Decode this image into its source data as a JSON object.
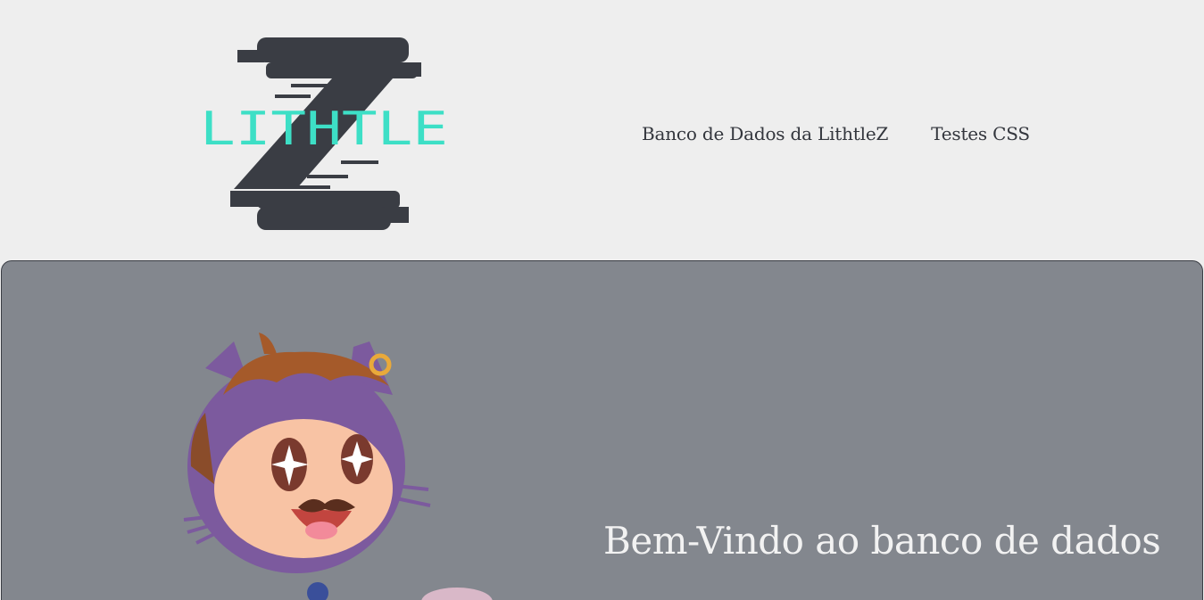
{
  "brand": {
    "logo_text": "LITHTLE",
    "logo_letter": "Z",
    "logo_text_color": "#3ddfc6",
    "logo_shape_color": "#3a3d44"
  },
  "nav": {
    "items": [
      {
        "label": "Banco de Dados da LithtleZ"
      },
      {
        "label": "Testes CSS"
      }
    ]
  },
  "hero": {
    "title": "Bem-Vindo ao banco de dados",
    "background": "#83878e",
    "illustration": "octocat-mascot"
  },
  "colors": {
    "page_bg": "#eeeeee",
    "text_dark": "#33363d",
    "hero_text": "#f2f2f2"
  }
}
